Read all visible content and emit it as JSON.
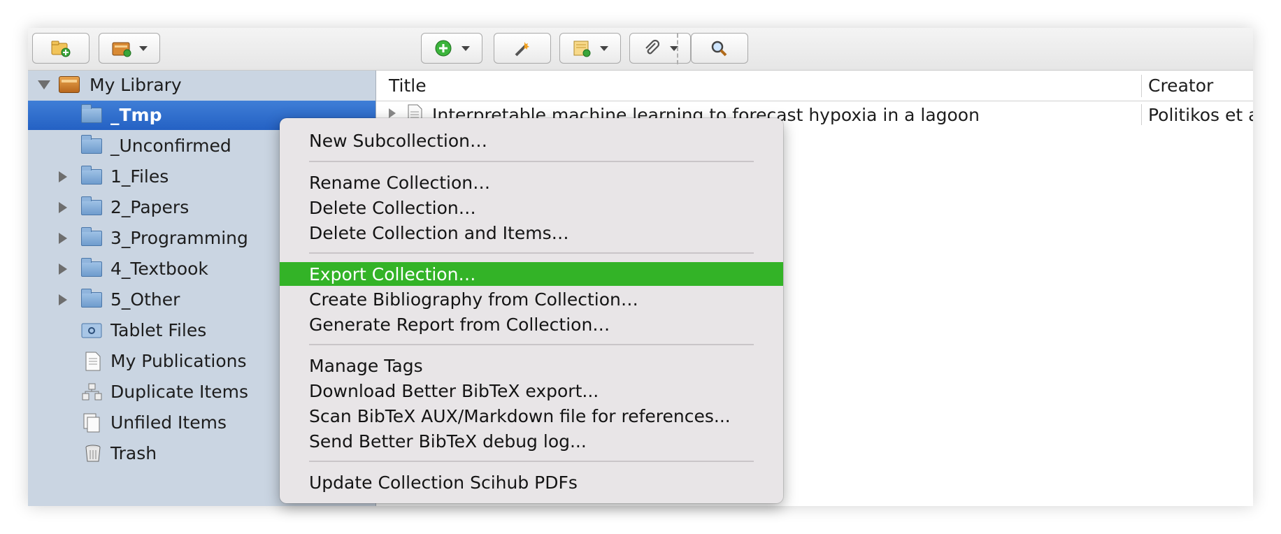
{
  "sidebar": {
    "items": [
      {
        "label": "My Library",
        "icon": "library-icon",
        "twisty": "down"
      },
      {
        "label": "_Tmp",
        "icon": "folder-icon",
        "twisty": "none",
        "selected": true
      },
      {
        "label": "_Unconfirmed",
        "icon": "folder-icon",
        "twisty": "none"
      },
      {
        "label": "1_Files",
        "icon": "folder-icon",
        "twisty": "right"
      },
      {
        "label": "2_Papers",
        "icon": "folder-icon",
        "twisty": "right"
      },
      {
        "label": "3_Programming",
        "icon": "folder-icon",
        "twisty": "right"
      },
      {
        "label": "4_Textbook",
        "icon": "folder-icon",
        "twisty": "right"
      },
      {
        "label": "5_Other",
        "icon": "folder-icon",
        "twisty": "right"
      },
      {
        "label": "Tablet Files",
        "icon": "tablet-folder-icon",
        "twisty": "none"
      },
      {
        "label": "My Publications",
        "icon": "document-icon",
        "twisty": "none"
      },
      {
        "label": "Duplicate Items",
        "icon": "duplicate-icon",
        "twisty": "none"
      },
      {
        "label": "Unfiled Items",
        "icon": "unfiled-icon",
        "twisty": "none"
      },
      {
        "label": "Trash",
        "icon": "trash-icon",
        "twisty": "none"
      }
    ]
  },
  "table": {
    "columns": [
      "Title",
      "Creator"
    ],
    "rows": [
      {
        "title": "Interpretable machine learning to forecast hypoxia in a lagoon",
        "creator": "Politikos et al"
      }
    ]
  },
  "context_menu": {
    "items": [
      "New Subcollection…",
      "Rename Collection…",
      "Delete Collection…",
      "Delete Collection and Items…",
      "Export Collection…",
      "Create Bibliography from Collection…",
      "Generate Report from Collection…",
      "Manage Tags",
      "Download Better BibTeX export...",
      "Scan BibTeX AUX/Markdown file for references...",
      "Send Better BibTeX debug log...",
      "Update Collection Scihub PDFs"
    ],
    "highlighted": "Export Collection…"
  },
  "colors": {
    "sidebar_bg": "#cad5e2",
    "selection": "#2f6fcf",
    "menu_highlight": "#33b327",
    "menu_bg": "#e8e5e7"
  }
}
